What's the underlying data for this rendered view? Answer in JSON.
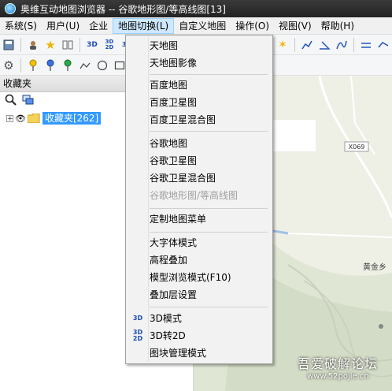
{
  "window": {
    "title": "奥维互动地图浏览器 -- 谷歌地形图/等高线图[13]"
  },
  "menubar": {
    "items": [
      {
        "label": "系统(S)"
      },
      {
        "label": "用户(U)"
      },
      {
        "label": "企业"
      },
      {
        "label": "地图切换(L)",
        "active": true
      },
      {
        "label": "自定义地图"
      },
      {
        "label": "操作(O)"
      },
      {
        "label": "视图(V)"
      },
      {
        "label": "帮助(H)"
      }
    ]
  },
  "left_panel": {
    "header": "收藏夹",
    "tree_root": "收藏夹[262]"
  },
  "map": {
    "road_label": "X069",
    "place_label": "黄金乡"
  },
  "dropdown": {
    "items": [
      "天地图",
      "天地图影像",
      "百度地图",
      "百度卫星图",
      "百度卫星混合图",
      "谷歌地图",
      "谷歌卫星图",
      "谷歌卫星混合图",
      "谷歌地形图/等高线图",
      "定制地图菜单",
      "大字体模式",
      "高程叠加",
      "模型浏览模式(F10)",
      "叠加层设置",
      "3D模式",
      "3D转2D",
      "图块管理模式"
    ],
    "icons": {
      "mode3d": "3D",
      "to2d_top": "3D",
      "to2d_bottom": "2D"
    }
  },
  "watermark": {
    "line1": "吾爱破解论坛",
    "line2": "www.52pojie.cn"
  }
}
